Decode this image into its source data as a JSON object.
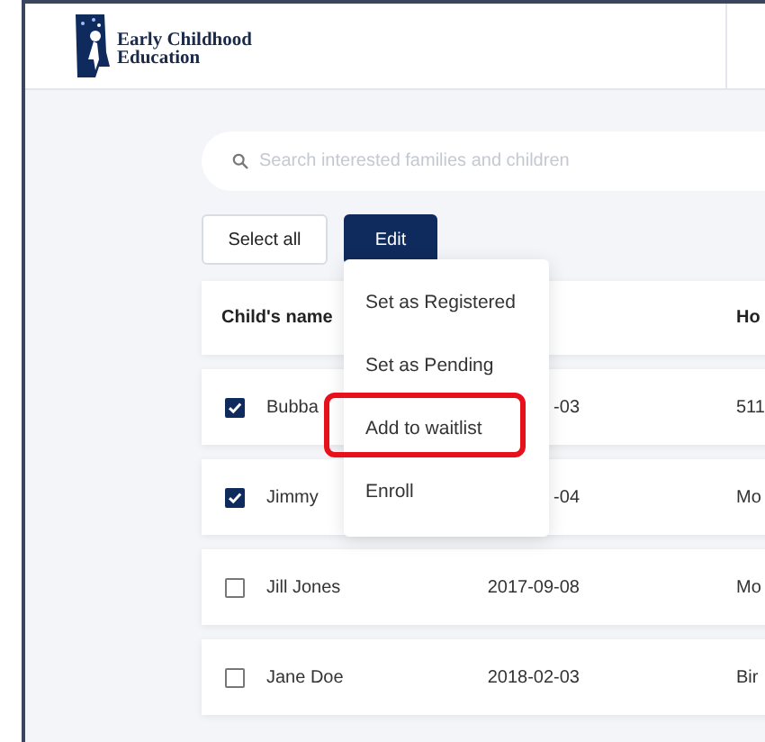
{
  "header": {
    "logo_title": "Early Childhood",
    "logo_subtitle": "Education"
  },
  "search": {
    "placeholder": "Search interested families and children"
  },
  "buttons": [
    {
      "label": "Select all",
      "kind": "secondary"
    },
    {
      "label": "Edit",
      "kind": "primary"
    }
  ],
  "table": {
    "columns": [
      {
        "label": "Child's name",
        "kind": "name"
      },
      {
        "label": "Ho",
        "kind": "column_3"
      }
    ],
    "rows": [
      {
        "checked": true,
        "name": "Bubba",
        "date": "-03",
        "column_3": "511"
      },
      {
        "checked": true,
        "name": "Jimmy",
        "date": "-04",
        "column_3": "Mo"
      },
      {
        "checked": false,
        "name": "Jill Jones",
        "date": "2017-09-08",
        "column_3": "Mo"
      },
      {
        "checked": false,
        "name": "Jane Doe",
        "date": "2018-02-03",
        "column_3": "Bir"
      }
    ]
  },
  "menu": {
    "items": [
      {
        "label": "Set as Registered",
        "highlighted": false
      },
      {
        "label": "Set as Pending",
        "highlighted": false
      },
      {
        "label": "Add to waitlist",
        "highlighted": true
      },
      {
        "label": "Enroll",
        "highlighted": false
      }
    ]
  }
}
